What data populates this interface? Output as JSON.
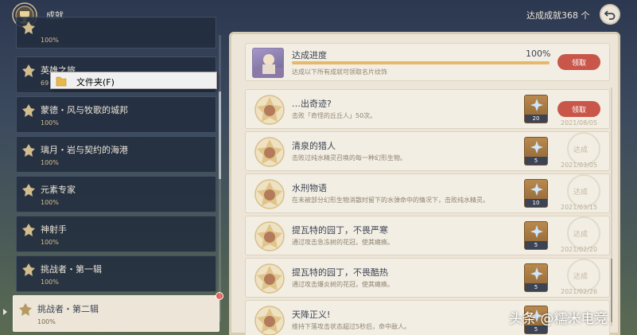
{
  "header": {
    "title": "成就",
    "count_label": "达成成就",
    "count_value": "368 个"
  },
  "sidebar": {
    "items": [
      {
        "label": "",
        "pct": "100%"
      },
      {
        "label": "英雄之旅",
        "pct": "69"
      },
      {
        "label": "蒙德・风与牧歌的城邦",
        "pct": "100%"
      },
      {
        "label": "璃月・岩与契约的海港",
        "pct": "100%"
      },
      {
        "label": "元素专家",
        "pct": "100%"
      },
      {
        "label": "神射手",
        "pct": "100%"
      },
      {
        "label": "挑战者・第一辑",
        "pct": "100%"
      },
      {
        "label": "挑战者・第二辑",
        "pct": "100%"
      }
    ]
  },
  "context_menu": {
    "label": "文件夹(F)"
  },
  "progress": {
    "title": "达成进度",
    "percent_text": "100%",
    "value": 1.0,
    "desc": "达成以下所有成就可领取名片纹饰",
    "claim_label": "领取"
  },
  "achievements": [
    {
      "title": "…出奇迹?",
      "desc": "击败「奇怪的丘丘人」50次。",
      "reward": "20",
      "date": "2021/08/05",
      "status": "claim",
      "claim_label": "领取"
    },
    {
      "title": "清泉的猎人",
      "desc": "击败过纯水精灵召唤的每一种幻形生物。",
      "reward": "5",
      "date": "2021/03/05",
      "status": "done",
      "done_label": "达成"
    },
    {
      "title": "水刑物语",
      "desc": "在未被部分幻形生物消散时留下的水弹命中的情况下，击败纯水精灵。",
      "reward": "10",
      "date": "2021/03/15",
      "status": "done",
      "done_label": "达成"
    },
    {
      "title": "提瓦特的园丁，不畏严寒",
      "desc": "通过攻击急冻树的花冠，使其瘫痪。",
      "reward": "5",
      "date": "2021/02/20",
      "status": "done",
      "done_label": "达成"
    },
    {
      "title": "提瓦特的园丁，不畏酷热",
      "desc": "通过攻击爆炎树的花冠，使其瘫痪。",
      "reward": "5",
      "date": "2021/02/26",
      "status": "done",
      "done_label": "达成"
    },
    {
      "title": "天降正义!",
      "desc": "维持下落攻击状态超过5秒后，命中敌人。",
      "reward": "5",
      "date": "",
      "status": "done",
      "done_label": ""
    }
  ],
  "watermark": "头条 @糯米电竞",
  "colors": {
    "accent": "#c8574a",
    "gold": "#d3bc8e",
    "panel": "#ece5d8",
    "dark": "#3b4354"
  }
}
